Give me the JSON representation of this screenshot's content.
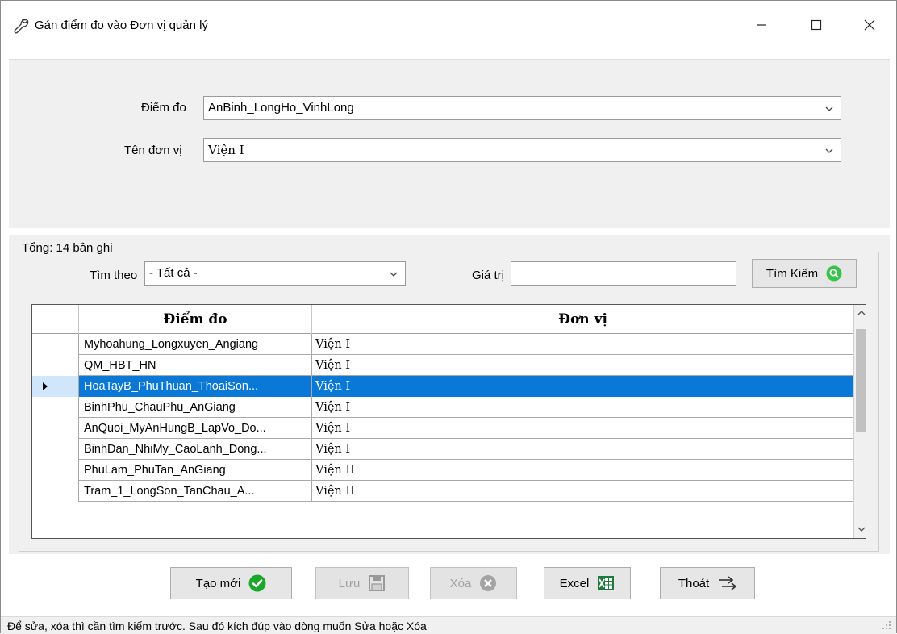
{
  "window": {
    "title": "Gán điểm đo vào Đơn vị quản lý",
    "icon": "wrench-icon"
  },
  "form": {
    "diem_do_label": "Điểm đo",
    "diem_do_value": "AnBinh_LongHo_VinhLong",
    "ten_don_vi_label": "Tên đơn vị",
    "ten_don_vi_value": "Viện I"
  },
  "search": {
    "group_title": "Tổng: 14 bản ghi",
    "tim_theo_label": "Tìm theo",
    "tim_theo_value": "- Tất cả -",
    "gia_tri_label": "Giá trị",
    "gia_tri_value": "",
    "search_button": "Tìm Kiếm"
  },
  "grid": {
    "columns": [
      "Điểm đo",
      "Đơn vị"
    ],
    "rows": [
      {
        "diem_do": "Myhoahung_Longxuyen_Angiang",
        "don_vi": "Viện I"
      },
      {
        "diem_do": "QM_HBT_HN",
        "don_vi": "Viện I"
      },
      {
        "diem_do": "HoaTayB_PhuThuan_ThoaiSon...",
        "don_vi": "Viện I"
      },
      {
        "diem_do": "BinhPhu_ChauPhu_AnGiang",
        "don_vi": "Viện I"
      },
      {
        "diem_do": "AnQuoi_MyAnHungB_LapVo_Do...",
        "don_vi": "Viện I"
      },
      {
        "diem_do": "BinhDan_NhiMy_CaoLanh_Dong...",
        "don_vi": "Viện I"
      },
      {
        "diem_do": "PhuLam_PhuTan_AnGiang",
        "don_vi": "Viện II"
      },
      {
        "diem_do": "Tram_1_LongSon_TanChau_A...",
        "don_vi": "Viện II"
      }
    ],
    "selected_row": 2
  },
  "buttons": {
    "tao_moi": "Tạo mới",
    "luu": "Lưu",
    "xoa": "Xóa",
    "excel": "Excel",
    "thoat": "Thoát"
  },
  "status": {
    "text": "Để sửa, xóa thì cần tìm kiếm trước. Sau đó kích đúp vào dòng muốn Sửa hoặc Xóa"
  },
  "colors": {
    "selection": "#0a78d7",
    "panel": "#f0f0f0",
    "ok_green": "#1aa82a",
    "excel_green": "#1d7a3a"
  }
}
